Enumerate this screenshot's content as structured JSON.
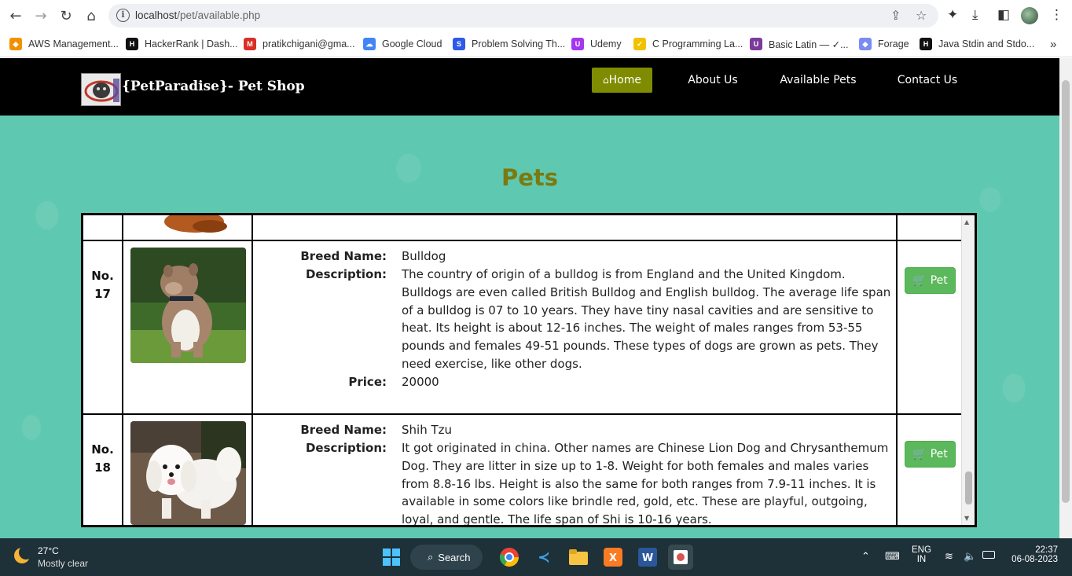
{
  "browser": {
    "url_host": "localhost",
    "url_path": "/pet/available.php",
    "bookmarks": [
      {
        "label": "AWS Management...",
        "icon": "aws-icon",
        "color": "#f29100"
      },
      {
        "label": "HackerRank | Dash...",
        "icon": "hackerrank-icon",
        "color": "#111111"
      },
      {
        "label": "pratikchigani@gma...",
        "icon": "gmail-icon",
        "color": "#d93025"
      },
      {
        "label": "Google Cloud",
        "icon": "google-cloud-icon",
        "color": "#4285f4"
      },
      {
        "label": "Problem Solving Th...",
        "icon": "scaler-icon",
        "color": "#2d5ae6"
      },
      {
        "label": "Udemy",
        "icon": "udemy-icon",
        "color": "#a435f0"
      },
      {
        "label": "C Programming La...",
        "icon": "c-lang-icon",
        "color": "#f2c200"
      },
      {
        "label": "Basic Latin — ✓...",
        "icon": "unicode-table-icon",
        "color": "#7a3b9b"
      },
      {
        "label": "Forage",
        "icon": "forage-icon",
        "color": "#7a8bf2"
      },
      {
        "label": "Java Stdin and Stdo...",
        "icon": "hackerrank-icon",
        "color": "#111111"
      }
    ],
    "more_label": "»"
  },
  "site": {
    "brand": "{PetParadise}- Pet Shop",
    "menu": {
      "home": "Home",
      "about": "About Us",
      "available": "Available Pets",
      "contact": "Contact Us"
    },
    "heading": "Pets"
  },
  "pets": [
    {
      "no": "No.",
      "num": "17",
      "breed_label": "Breed Name:",
      "breed": "Bulldog",
      "desc_label": "Description:",
      "description": "The country of origin of a bulldog is from England and the United Kingdom. Bulldogs are even called British Bulldog and English bulldog. The average life span of a bulldog is 07 to 10 years. They have tiny nasal cavities and are sensitive to heat. Its height is about 12-16 inches. The weight of males ranges from 53-55 pounds and females 49-51 pounds. These types of dogs are grown as pets. They need exercise, like other dogs.",
      "price_label": "Price:",
      "price": "20000",
      "button": "Pet"
    },
    {
      "no": "No.",
      "num": "18",
      "breed_label": "Breed Name:",
      "breed": "Shih Tzu",
      "desc_label": "Description:",
      "description": "It got originated in china. Other names are Chinese Lion Dog and Chrysanthemum Dog. They are litter in size up to 1-8. Weight for both females and males varies from 8.8-16 lbs. Height is also the same for both ranges from 7.9-11 inches. It is available in some colors like brindle red, gold, etc. These are playful, outgoing, loyal, and gentle. The life span of Shi is 10-16 years.",
      "button": "Pet"
    }
  ],
  "taskbar": {
    "weather_temp": "27°C",
    "weather_text": "Mostly clear",
    "search_label": "Search",
    "lang_top": "ENG",
    "lang_bottom": "IN",
    "time": "22:37",
    "date": "06-08-2023"
  },
  "colors": {
    "page_bg": "#5fc8b0",
    "header_bg": "#000000",
    "home_active": "#7f8b00",
    "heading": "#7a7a10",
    "pet_button": "#5cb85c"
  }
}
